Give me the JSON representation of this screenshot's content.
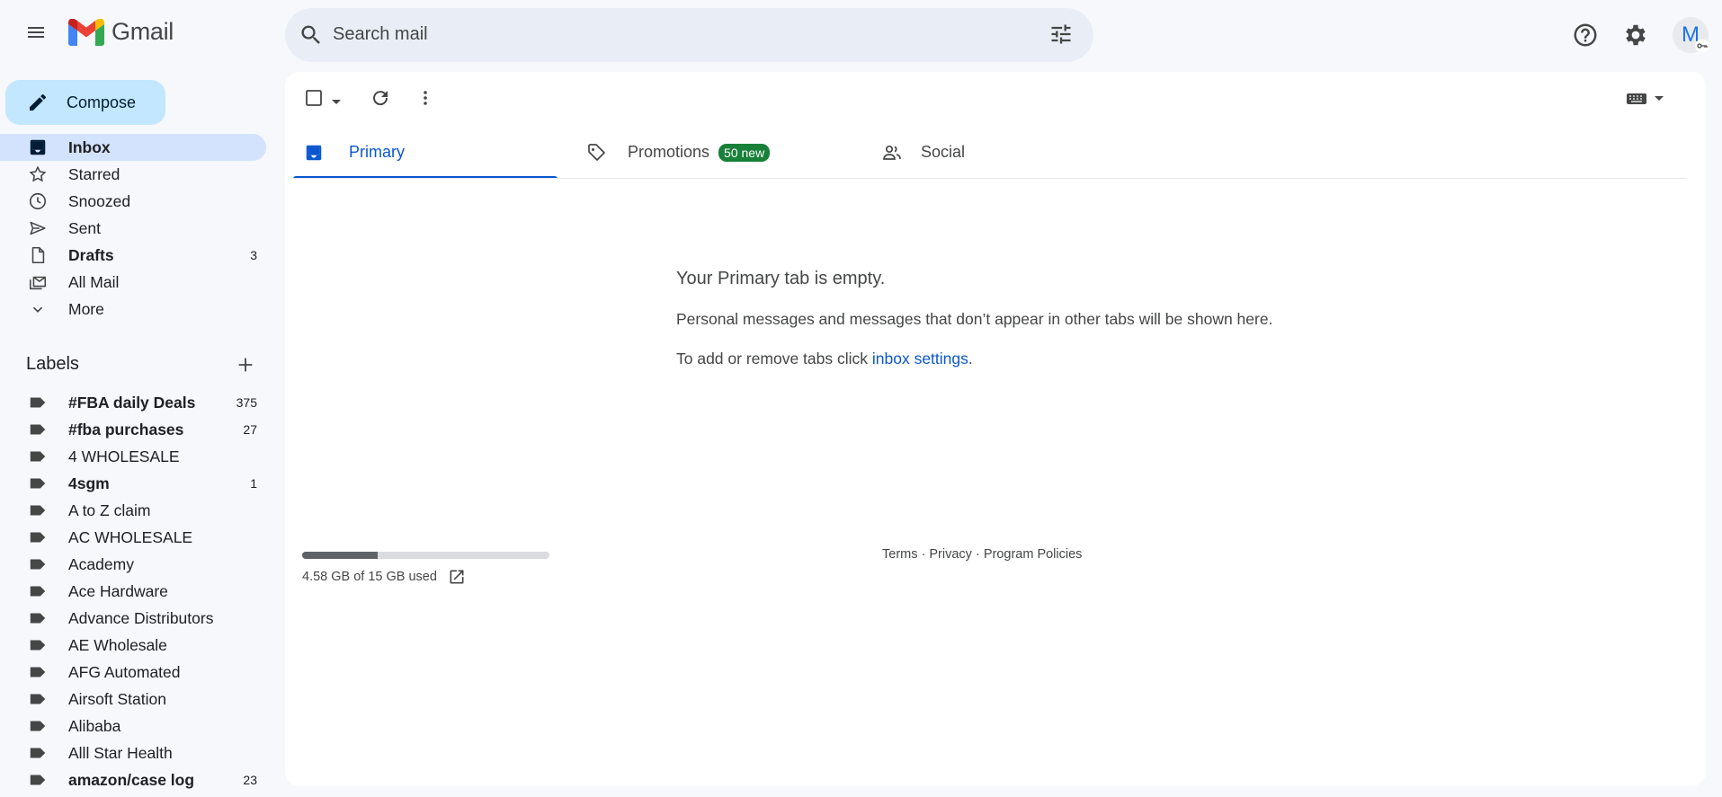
{
  "header": {
    "logo_text": "Gmail",
    "search_placeholder": "Search mail",
    "avatar_letter": "M"
  },
  "sidebar": {
    "compose_label": "Compose",
    "nav": [
      {
        "label": "Inbox",
        "icon": "inbox-icon",
        "count": "",
        "active": true,
        "bold": true
      },
      {
        "label": "Starred",
        "icon": "star-icon",
        "count": "",
        "active": false,
        "bold": false
      },
      {
        "label": "Snoozed",
        "icon": "clock-icon",
        "count": "",
        "active": false,
        "bold": false
      },
      {
        "label": "Sent",
        "icon": "send-icon",
        "count": "",
        "active": false,
        "bold": false
      },
      {
        "label": "Drafts",
        "icon": "draft-icon",
        "count": "3",
        "active": false,
        "bold": true
      },
      {
        "label": "All Mail",
        "icon": "all-mail-icon",
        "count": "",
        "active": false,
        "bold": false
      },
      {
        "label": "More",
        "icon": "chevron-down-icon",
        "count": "",
        "active": false,
        "bold": false
      }
    ],
    "labels_header": "Labels",
    "labels": [
      {
        "label": "#FBA daily Deals",
        "count": "375",
        "bold": true
      },
      {
        "label": "#fba purchases",
        "count": "27",
        "bold": true
      },
      {
        "label": "4 WHOLESALE",
        "count": "",
        "bold": false
      },
      {
        "label": "4sgm",
        "count": "1",
        "bold": true
      },
      {
        "label": "A to Z claim",
        "count": "",
        "bold": false
      },
      {
        "label": "AC WHOLESALE",
        "count": "",
        "bold": false
      },
      {
        "label": "Academy",
        "count": "",
        "bold": false
      },
      {
        "label": "Ace Hardware",
        "count": "",
        "bold": false
      },
      {
        "label": "Advance Distributors",
        "count": "",
        "bold": false
      },
      {
        "label": "AE Wholesale",
        "count": "",
        "bold": false
      },
      {
        "label": "AFG Automated",
        "count": "",
        "bold": false
      },
      {
        "label": "Airsoft Station",
        "count": "",
        "bold": false
      },
      {
        "label": "Alibaba",
        "count": "",
        "bold": false
      },
      {
        "label": "Alll Star Health",
        "count": "",
        "bold": false
      },
      {
        "label": "amazon/case log",
        "count": "23",
        "bold": true
      }
    ]
  },
  "tabs": [
    {
      "label": "Primary",
      "badge": ""
    },
    {
      "label": "Promotions",
      "badge": "50 new"
    },
    {
      "label": "Social",
      "badge": ""
    }
  ],
  "empty": {
    "title": "Your Primary tab is empty.",
    "message": "Personal messages and messages that don’t appear in other tabs will be shown here.",
    "tabs_text": "To add or remove tabs click ",
    "tabs_link": "inbox settings",
    "tabs_end": "."
  },
  "storage": {
    "used_fraction": 0.305,
    "text": "4.58 GB of 15 GB used"
  },
  "footer": {
    "terms": "Terms",
    "sep": " · ",
    "privacy": "Privacy",
    "policies": "Program Policies"
  },
  "colors": {
    "accent": "#0b57d0",
    "compose_bg": "#c2e7ff",
    "active_nav_bg": "#d3e3fd",
    "badge_bg": "#188038"
  }
}
